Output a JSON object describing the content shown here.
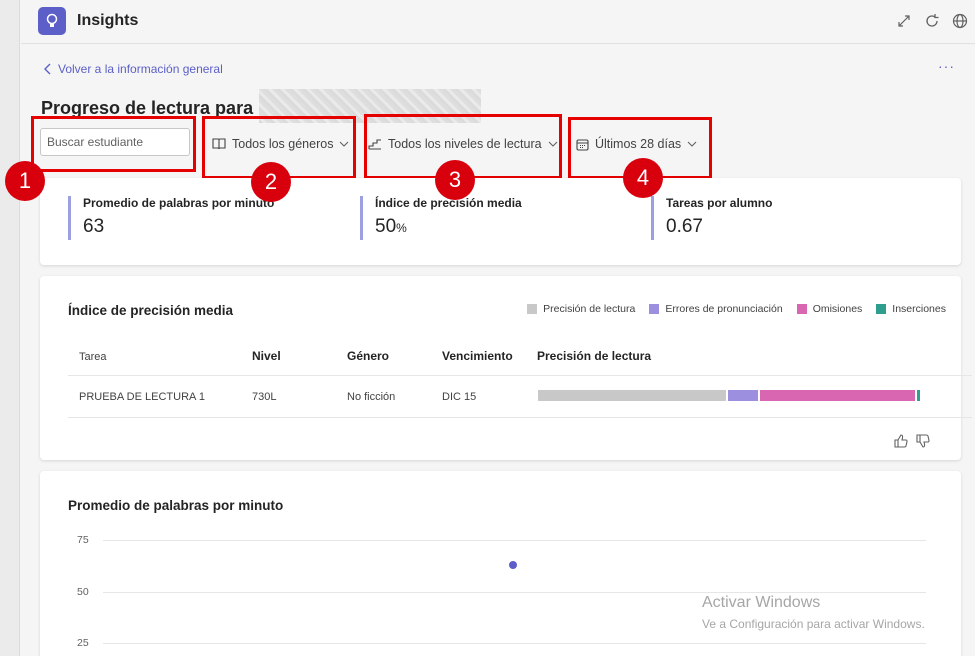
{
  "app": {
    "title": "Insights",
    "icon": "lightbulb-icon"
  },
  "titlebar_icons": [
    "expand-icon",
    "refresh-icon",
    "globe-icon"
  ],
  "nav": {
    "back_label": "Volver a la información general",
    "more": "···"
  },
  "page": {
    "title": "Progreso de lectura para"
  },
  "filters": {
    "search_placeholder": "Buscar estudiante",
    "genres": "Todos los géneros",
    "levels": "Todos los niveles de lectura",
    "period": "Últimos 28 días"
  },
  "callouts": [
    "1",
    "2",
    "3",
    "4"
  ],
  "kpis": [
    {
      "label": "Promedio de palabras por minuto",
      "value": "63",
      "unit": ""
    },
    {
      "label": "Índice de precisión media",
      "value": "50",
      "unit": "%"
    },
    {
      "label": "Tareas por alumno",
      "value": "0.67",
      "unit": ""
    }
  ],
  "accuracy": {
    "title": "Índice de precisión media",
    "legend": [
      {
        "label": "Precisión de lectura",
        "color": "#c8c8c8"
      },
      {
        "label": "Errores de pronunciación",
        "color": "#9c8fdf"
      },
      {
        "label": "Omisiones",
        "color": "#d966b0"
      },
      {
        "label": "Inserciones",
        "color": "#2f9e8f"
      }
    ],
    "headers": {
      "task": "Tarea",
      "level": "Nivel",
      "genre": "Género",
      "due": "Vencimiento",
      "precision": "Precisión de lectura"
    },
    "rows": [
      {
        "task": "PRUEBA DE LECTURA 1",
        "level": "730L",
        "genre": "No ficción",
        "due": "DIC 15",
        "segments": [
          0.5,
          0.085,
          0.415,
          0.012
        ]
      }
    ]
  },
  "wpm_chart": {
    "title": "Promedio de palabras por minuto",
    "chart_data": {
      "type": "scatter",
      "title": "Promedio de palabras por minuto",
      "y_ticks": [
        "75",
        "50",
        "25"
      ],
      "points": [
        {
          "y": 63
        }
      ]
    }
  },
  "watermark": {
    "line1": "Activar Windows",
    "line2": "Ve a Configuración para activar Windows."
  }
}
